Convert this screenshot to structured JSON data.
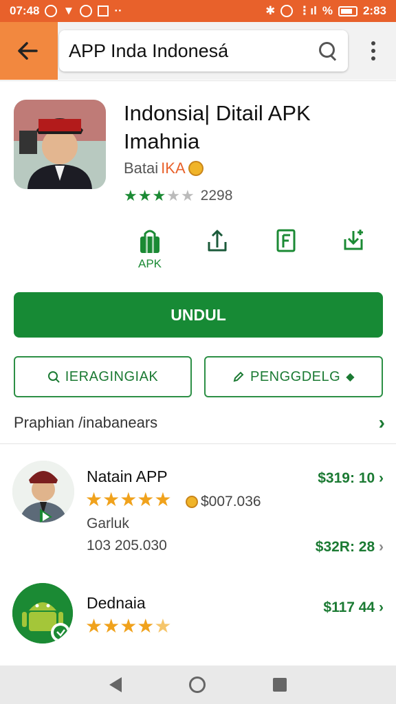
{
  "status_bar": {
    "time": "07:48",
    "right_text": "2:83",
    "percent": "%"
  },
  "search": {
    "query": "APP  Inda Indonesá"
  },
  "app": {
    "title": "Indonsia| Ditail APK Imahnia",
    "developer_prefix": "Batai",
    "developer_accent": "IKA",
    "rating_count": "2298",
    "rating_stars": 3,
    "rating_max": 5
  },
  "actions": {
    "apk_label": "APK"
  },
  "buttons": {
    "download": "UNDUL",
    "left_outline": "IERAGINGIAK",
    "right_outline": "PENGGDELG"
  },
  "section": {
    "title": "Praphian /inabanears"
  },
  "list": [
    {
      "name": "Natain APP",
      "stars": 5,
      "price_note": "$007.036",
      "category": "Garluk",
      "downloads": "103 205.030",
      "price_top": "$319: 10",
      "price_bottom": "$32R: 28"
    },
    {
      "name": "Dednaia",
      "stars": 5,
      "price_top": "$117 44"
    }
  ],
  "colors": {
    "status_bar": "#e8612b",
    "accent_green": "#178a35",
    "star_orange": "#f0a21c"
  }
}
